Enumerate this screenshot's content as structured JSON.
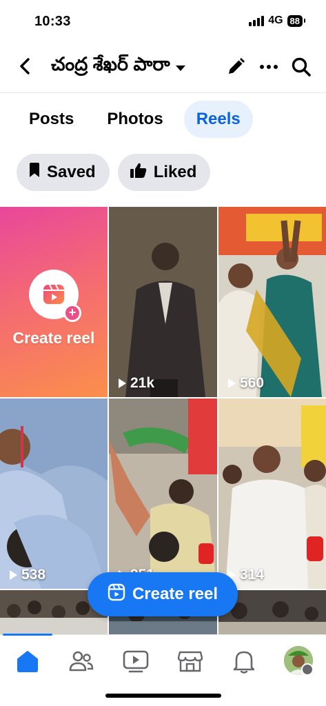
{
  "status_bar": {
    "time": "10:33",
    "network": "4G",
    "battery": "88"
  },
  "header": {
    "title": "చంద్ర శేఖర్ పారా",
    "icons": [
      "back-arrow-icon",
      "chevron-down-icon",
      "pencil-icon",
      "more-icon",
      "search-icon"
    ]
  },
  "tabs": [
    {
      "label": "Posts",
      "active": false
    },
    {
      "label": "Photos",
      "active": false
    },
    {
      "label": "Reels",
      "active": true
    }
  ],
  "filters": [
    {
      "label": "Saved",
      "icon": "bookmark-icon"
    },
    {
      "label": "Liked",
      "icon": "thumbs-up-icon"
    }
  ],
  "create_tile": {
    "label": "Create reel",
    "icon": "reels-icon"
  },
  "reels": [
    {
      "views": "21k"
    },
    {
      "views": "560"
    },
    {
      "views": "538"
    },
    {
      "views": "951"
    },
    {
      "views": "314"
    }
  ],
  "fab": {
    "label": "Create reel",
    "icon": "reels-icon"
  },
  "bottom_nav": [
    {
      "name": "home",
      "icon": "home-icon",
      "active": true
    },
    {
      "name": "friends",
      "icon": "friends-icon",
      "active": false
    },
    {
      "name": "video",
      "icon": "video-icon",
      "active": false
    },
    {
      "name": "marketplace",
      "icon": "marketplace-icon",
      "active": false
    },
    {
      "name": "notifications",
      "icon": "bell-icon",
      "active": false
    },
    {
      "name": "profile",
      "icon": "avatar-icon",
      "active": false
    }
  ],
  "colors": {
    "accent": "#1877f2",
    "tab_active_bg": "#e7f1fd",
    "chip_bg": "#e4e6eb"
  }
}
